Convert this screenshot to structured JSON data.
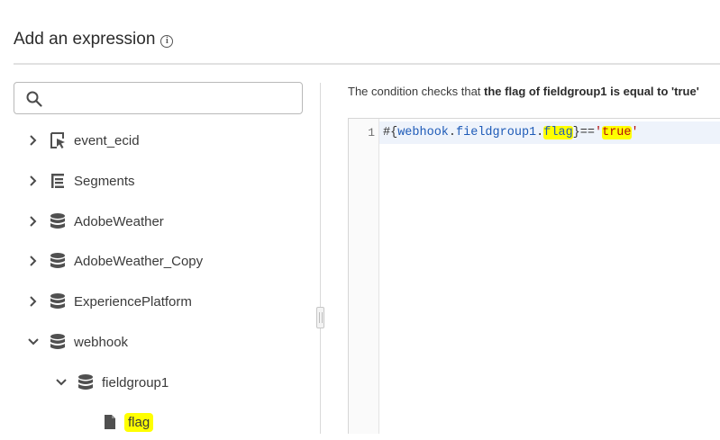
{
  "header": {
    "title": "Add an expression",
    "info_icon": "info-icon"
  },
  "search": {
    "placeholder": "",
    "value": "",
    "icon": "search-icon"
  },
  "tree": {
    "items": [
      {
        "label": "event_ecid",
        "icon": "pointer-cursor-icon",
        "expanded": false,
        "level": 0
      },
      {
        "label": "Segments",
        "icon": "list-tree-icon",
        "expanded": false,
        "level": 0
      },
      {
        "label": "AdobeWeather",
        "icon": "database-icon",
        "expanded": false,
        "level": 0
      },
      {
        "label": "AdobeWeather_Copy",
        "icon": "database-icon",
        "expanded": false,
        "level": 0
      },
      {
        "label": "ExperiencePlatform",
        "icon": "database-icon",
        "expanded": false,
        "level": 0
      },
      {
        "label": "webhook",
        "icon": "database-icon",
        "expanded": true,
        "level": 0
      },
      {
        "label": "fieldgroup1",
        "icon": "database-icon",
        "expanded": true,
        "level": 1
      },
      {
        "label": "flag",
        "icon": "file-icon",
        "level": 2,
        "highlighted": true
      }
    ]
  },
  "condition": {
    "prefix": "The condition checks that ",
    "bold": "the flag of fieldgroup1 is equal to 'true'"
  },
  "editor": {
    "line_number": "1",
    "tokens": {
      "open": "#{",
      "object": "webhook",
      "dot1": ".",
      "group": "fieldgroup1",
      "dot2": ".",
      "field": "flag",
      "close": "}",
      "operator": "==",
      "quote_open": "'",
      "literal": "true",
      "quote_close": "'"
    }
  },
  "colors": {
    "highlight": "#ffff00",
    "identifier": "#1e5bb8",
    "string": "#b30c0c",
    "active_line": "#eef3fb"
  }
}
